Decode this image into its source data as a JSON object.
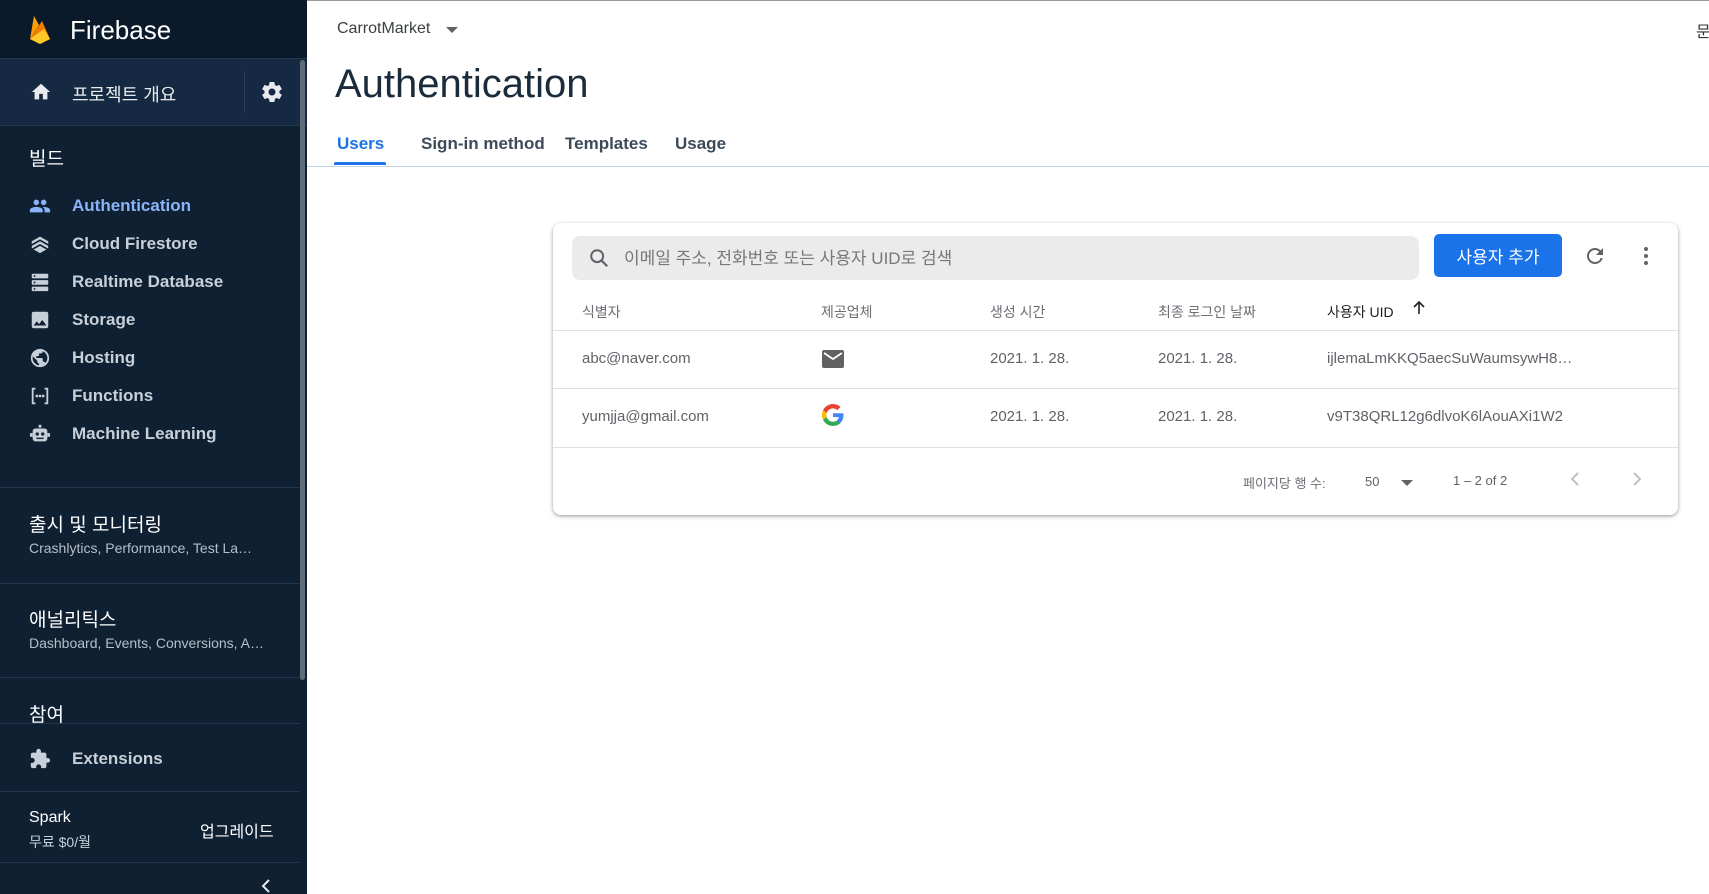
{
  "sidebar": {
    "brand": "Firebase",
    "project_overview": "프로젝트 개요",
    "build_title": "빌드",
    "build_items": [
      {
        "label": "Authentication",
        "icon": "people-icon",
        "active": true
      },
      {
        "label": "Cloud Firestore",
        "icon": "firestore-icon"
      },
      {
        "label": "Realtime Database",
        "icon": "database-icon"
      },
      {
        "label": "Storage",
        "icon": "image-icon"
      },
      {
        "label": "Hosting",
        "icon": "globe-icon"
      },
      {
        "label": "Functions",
        "icon": "functions-icon"
      },
      {
        "label": "Machine Learning",
        "icon": "robot-icon"
      }
    ],
    "release_title": "출시 및 모니터링",
    "release_sub": "Crashlytics, Performance, Test La…",
    "analytics_title": "애널리틱스",
    "analytics_sub": "Dashboard, Events, Conversions, A…",
    "engage_title": "참여",
    "extensions": "Extensions",
    "plan_name": "Spark",
    "plan_price": "무료 $0/월",
    "upgrade": "업그레이드"
  },
  "header": {
    "project": "CarrotMarket",
    "title": "Authentication",
    "topright": "문",
    "tabs": [
      "Users",
      "Sign-in method",
      "Templates",
      "Usage"
    ],
    "active_tab": "Users"
  },
  "users_panel": {
    "search_placeholder": "이메일 주소, 전화번호 또는 사용자 UID로 검색",
    "add_user": "사용자 추가",
    "columns": [
      "식별자",
      "제공업체",
      "생성 시간",
      "최종 로그인 날짜",
      "사용자 UID"
    ],
    "rows": [
      {
        "identifier": "abc@naver.com",
        "provider": "email-icon",
        "created": "2021. 1. 28.",
        "last_login": "2021. 1. 28.",
        "uid": "ijlemaLmKKQ5aecSuWaumsywH8…"
      },
      {
        "identifier": "yumjja@gmail.com",
        "provider": "google-icon",
        "created": "2021. 1. 28.",
        "last_login": "2021. 1. 28.",
        "uid": "v9T38QRL12g6dlvoK6lAouAXi1W2"
      }
    ],
    "rows_per_page_label": "페이지당 행 수:",
    "rows_per_page": "50",
    "range": "1 – 2 of 2"
  },
  "colors": {
    "sidebar_bg": "#0f2033",
    "accent": "#1a73e8",
    "active_nav": "#8ab4f8"
  }
}
